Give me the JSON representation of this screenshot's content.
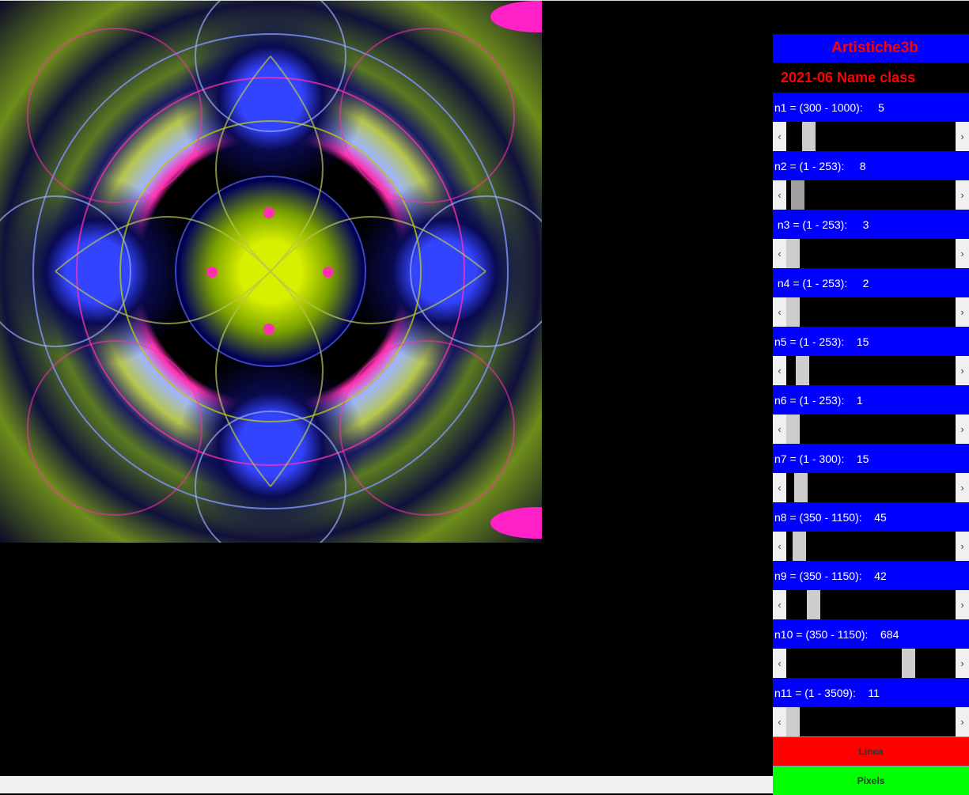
{
  "panel": {
    "title": "Artistiche3b",
    "subtitle": "2021-06  Name class",
    "params": [
      {
        "label": "n1 = (300 - 1000):     5",
        "min": 300,
        "max": 1000,
        "value": 5,
        "thumb_fraction": 0.1
      },
      {
        "label": "n2 = (1 - 253):     8",
        "min": 1,
        "max": 253,
        "value": 8,
        "thumb_fraction": 0.03
      },
      {
        "label": " n3 = (1 - 253):     3",
        "min": 1,
        "max": 253,
        "value": 3,
        "thumb_fraction": 0.0
      },
      {
        "label": " n4 = (1 - 253):     2",
        "min": 1,
        "max": 253,
        "value": 2,
        "thumb_fraction": 0.0
      },
      {
        "label": "n5 = (1 - 253):    15",
        "min": 1,
        "max": 253,
        "value": 15,
        "thumb_fraction": 0.06
      },
      {
        "label": "n6 = (1 - 253):    1",
        "min": 1,
        "max": 253,
        "value": 1,
        "thumb_fraction": 0.0
      },
      {
        "label": "n7 = (1 - 300):    15",
        "min": 1,
        "max": 300,
        "value": 15,
        "thumb_fraction": 0.05
      },
      {
        "label": "n8 = (350 - 1150):    45",
        "min": 350,
        "max": 1150,
        "value": 45,
        "thumb_fraction": 0.04
      },
      {
        "label": "n9 = (350 - 1150):    42",
        "min": 350,
        "max": 1150,
        "value": 42,
        "thumb_fraction": 0.13
      },
      {
        "label": "n10 = (350 - 1150):    684",
        "min": 350,
        "max": 1150,
        "value": 684,
        "thumb_fraction": 0.74
      },
      {
        "label": "n11 = (1 - 3509):    11",
        "min": 1,
        "max": 3509,
        "value": 11,
        "thumb_fraction": 0.0
      }
    ],
    "buttons": [
      {
        "label": "Linea",
        "color": "#ff0000"
      },
      {
        "label": "Pixels",
        "color": "#00ff00"
      }
    ]
  },
  "icons": {
    "left": "chevron-left-icon",
    "right": "chevron-right-icon"
  },
  "colors": {
    "panel_blue": "#0000ff",
    "title_red": "#ff0000",
    "background": "#000000"
  }
}
